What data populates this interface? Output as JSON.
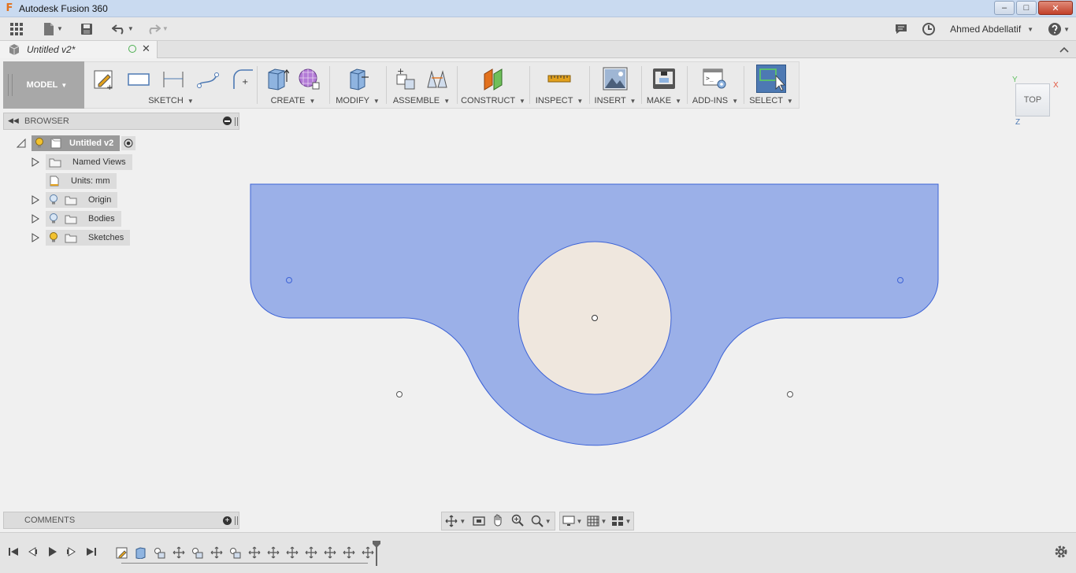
{
  "titlebar": {
    "title": "Autodesk Fusion 360",
    "app_logo": "F",
    "minimize": "–",
    "maximize": "□",
    "close": "✕"
  },
  "quickbar": {
    "user_name": "Ahmed Abdellatif"
  },
  "document_tab": {
    "name": "Untitled v2*"
  },
  "toolbar": {
    "workspace": "MODEL",
    "groups": [
      {
        "label": "SKETCH"
      },
      {
        "label": "CREATE"
      },
      {
        "label": "MODIFY"
      },
      {
        "label": "ASSEMBLE"
      },
      {
        "label": "CONSTRUCT"
      },
      {
        "label": "INSPECT"
      },
      {
        "label": "INSERT"
      },
      {
        "label": "MAKE"
      },
      {
        "label": "ADD-INS"
      },
      {
        "label": "SELECT"
      }
    ]
  },
  "browser": {
    "title": "BROWSER",
    "root": "Untitled v2",
    "items": [
      {
        "label": "Named Views"
      },
      {
        "label": "Units: mm"
      },
      {
        "label": "Origin"
      },
      {
        "label": "Bodies"
      },
      {
        "label": "Sketches"
      }
    ]
  },
  "viewcube": {
    "face": "TOP",
    "axis_y": "Y",
    "axis_x": "X",
    "axis_z": "Z"
  },
  "comments": {
    "title": "COMMENTS"
  },
  "colors": {
    "sketch_fill": "#9bb0e8",
    "sketch_stroke": "#3d63d6",
    "hole_fill": "#efe7de",
    "select_active": "#4d79b3",
    "accent_orange": "#e2711d"
  }
}
